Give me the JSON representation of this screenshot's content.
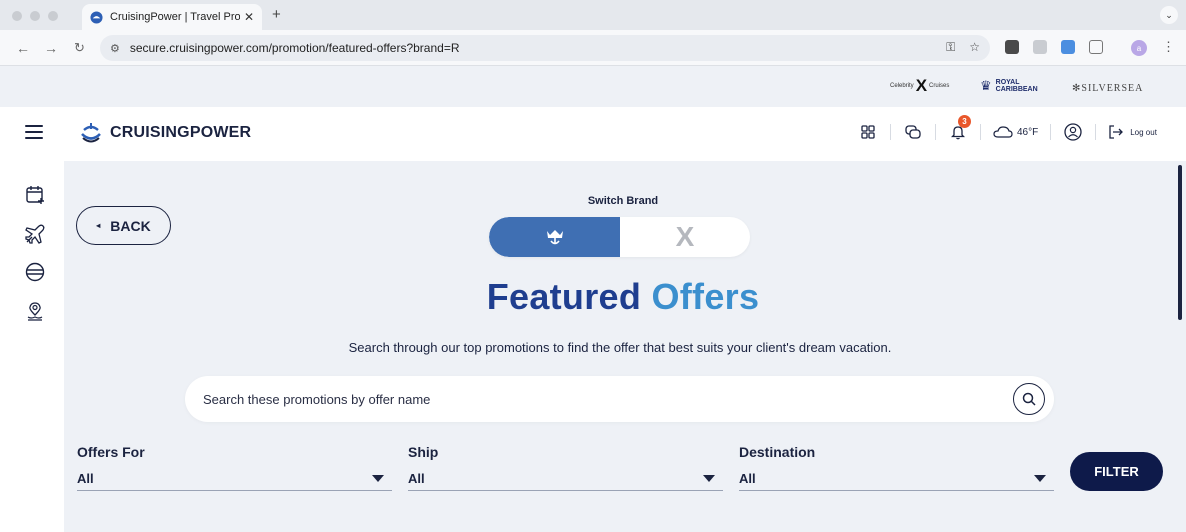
{
  "browser": {
    "tab_title": "CruisingPower | Travel Profes",
    "tab_close": "✕",
    "new_tab": "+",
    "url": "secure.cruisingpower.com/promotion/featured-offers?brand=R",
    "profile_initial": "a"
  },
  "brands_strip": {
    "celebrity": "Celebrity",
    "celebrity_x": "X",
    "celebrity_suffix": "Cruises",
    "royal_line1": "ROYAL",
    "royal_line2": "CARIBBEAN",
    "silversea": "SILVERSEA"
  },
  "header": {
    "logo_text": "CRUISINGPOWER",
    "notification_count": "3",
    "weather": "46°F",
    "logout": "Log out"
  },
  "page": {
    "back_label": "BACK",
    "switch_brand_label": "Switch Brand",
    "brand_options": [
      "Royal Caribbean",
      "Celebrity"
    ],
    "selected_brand": "Royal Caribbean",
    "title_part1": "Featured",
    "title_part2": "Offers",
    "subtitle": "Search through our top promotions to find the offer that best suits your client's dream vacation.",
    "search_placeholder": "Search these promotions by offer name"
  },
  "filters": {
    "offers_for": {
      "label": "Offers For",
      "value": "All"
    },
    "ship": {
      "label": "Ship",
      "value": "All"
    },
    "destination": {
      "label": "Destination",
      "value": "All"
    },
    "button": "FILTER"
  },
  "colors": {
    "navy": "#1b2340",
    "brand_blue": "#3f6fb3",
    "title_dark": "#1f3e8f",
    "title_light": "#3b8fce",
    "badge": "#e9572b",
    "filter_button": "#0e1a4a"
  },
  "icons": {
    "rail": [
      "calendar-plus-icon",
      "plane-icon",
      "globe-icon",
      "location-pin-icon"
    ],
    "header": [
      "grid-icon",
      "chat-icon",
      "bell-icon",
      "cloud-icon",
      "user-icon",
      "logout-icon"
    ]
  }
}
